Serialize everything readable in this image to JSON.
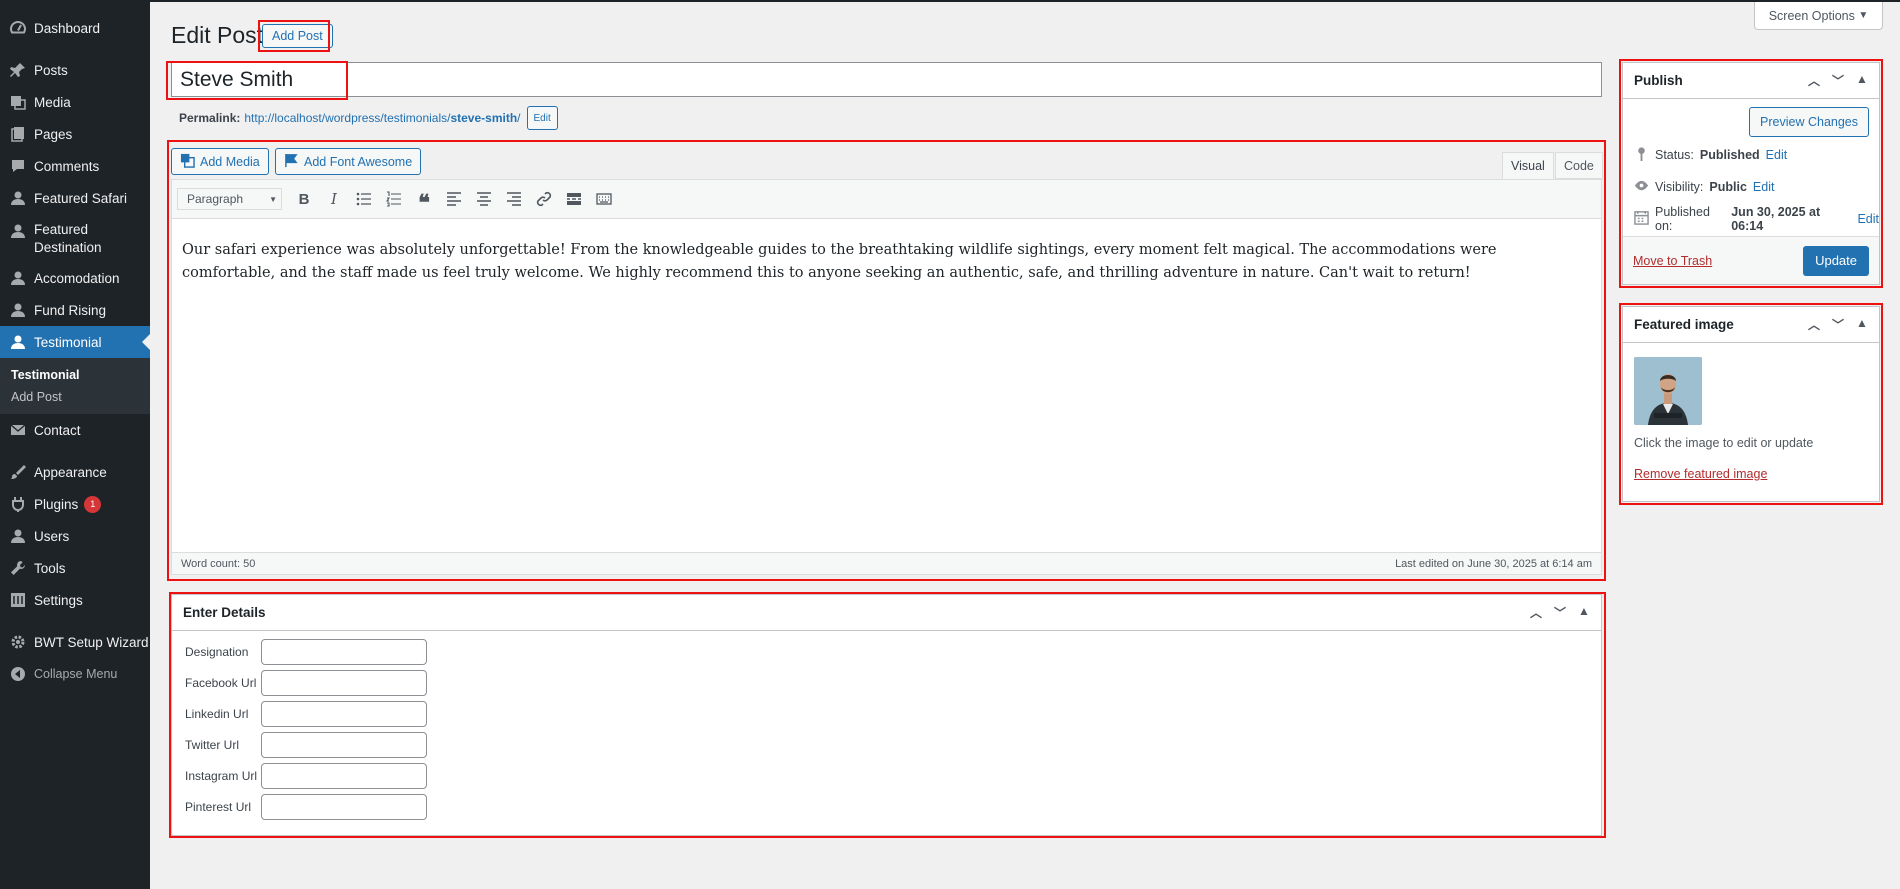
{
  "sidebar": {
    "items": [
      {
        "label": "Dashboard",
        "icon": "dashboard-icon"
      },
      {
        "label": "Posts",
        "icon": "pin-icon"
      },
      {
        "label": "Media",
        "icon": "media-icon"
      },
      {
        "label": "Pages",
        "icon": "pages-icon"
      },
      {
        "label": "Comments",
        "icon": "comments-icon"
      },
      {
        "label": "Featured Safari",
        "icon": "user-icon"
      },
      {
        "label": "Featured Destination",
        "icon": "user-icon"
      },
      {
        "label": "Accomodation",
        "icon": "user-icon"
      },
      {
        "label": "Fund Rising",
        "icon": "user-icon"
      },
      {
        "label": "Testimonial",
        "icon": "user-icon"
      },
      {
        "label": "Contact",
        "icon": "mail-icon"
      },
      {
        "label": "Appearance",
        "icon": "brush-icon"
      },
      {
        "label": "Plugins",
        "icon": "plugin-icon",
        "badge": "1"
      },
      {
        "label": "Users",
        "icon": "users-icon"
      },
      {
        "label": "Tools",
        "icon": "wrench-icon"
      },
      {
        "label": "Settings",
        "icon": "settings-icon"
      },
      {
        "label": "BWT Setup Wizard",
        "icon": "gear-icon"
      }
    ],
    "submenu": {
      "current": "Testimonial",
      "add": "Add Post"
    },
    "collapse": "Collapse Menu"
  },
  "screen_options": "Screen Options",
  "page": {
    "title": "Edit Post",
    "add_post": "Add Post"
  },
  "post": {
    "title": "Steve Smith",
    "permalink_label": "Permalink:",
    "permalink_base": "http://localhost/wordpress/testimonials/",
    "permalink_slug": "steve-smith",
    "permalink_end": "/",
    "permalink_edit": "Edit"
  },
  "editor": {
    "add_media": "Add Media",
    "add_font_awesome": "Add Font Awesome",
    "tab_visual": "Visual",
    "tab_code": "Code",
    "format": "Paragraph",
    "content": "Our safari experience was absolutely unforgettable! From the knowledgeable guides to the breathtaking wildlife sightings, every moment felt magical. The accommodations were comfortable, and the staff made us feel truly welcome. We highly recommend this to anyone seeking an authentic, safe, and thrilling adventure in nature. Can't wait to return!",
    "word_count": "Word count: 50",
    "last_edited": "Last edited on June 30, 2025 at 6:14 am"
  },
  "details": {
    "title": "Enter Details",
    "fields": [
      "Designation",
      "Facebook Url",
      "Linkedin Url",
      "Twitter Url",
      "Instagram Url",
      "Pinterest Url"
    ]
  },
  "publish": {
    "title": "Publish",
    "preview": "Preview Changes",
    "status_label": "Status:",
    "status_value": "Published",
    "visibility_label": "Visibility:",
    "visibility_value": "Public",
    "published_label": "Published on:",
    "published_value": "Jun 30, 2025 at 06:14",
    "edit": "Edit",
    "trash": "Move to Trash",
    "update": "Update"
  },
  "featured": {
    "title": "Featured image",
    "hint": "Click the image to edit or update",
    "remove": "Remove featured image"
  },
  "colors": {
    "accent": "#2271b1",
    "sidebar": "#1d2327",
    "highlight": "#e11111"
  }
}
